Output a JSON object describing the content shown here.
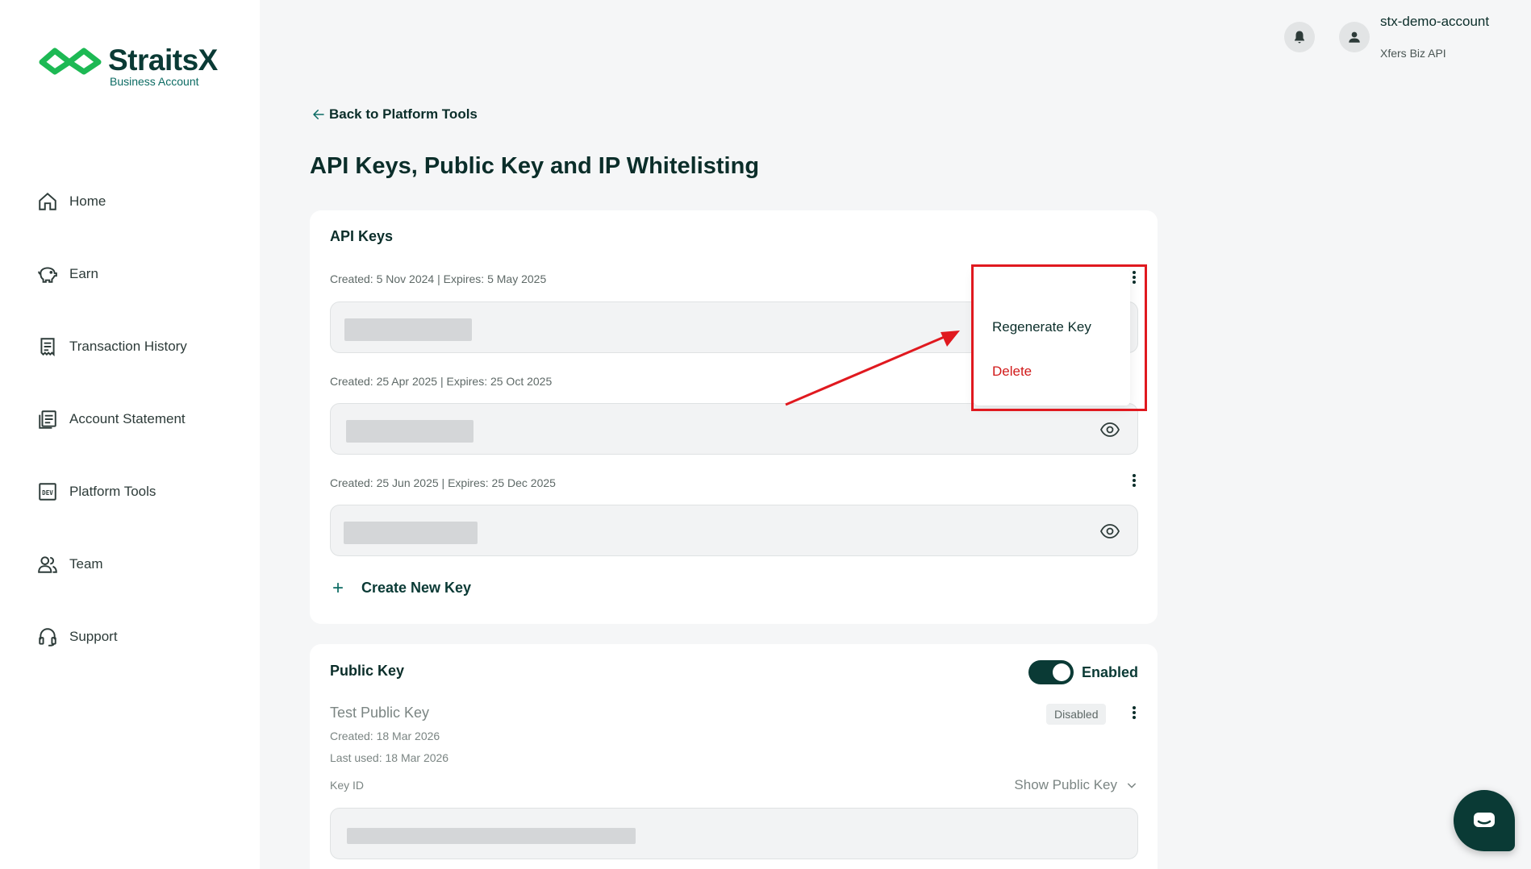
{
  "brand": {
    "name": "StraitsX",
    "subtitle": "Business Account",
    "accent": "#0a3a35",
    "logo_green": "#1db954"
  },
  "sidebar": {
    "items": [
      {
        "label": "Home",
        "icon": "home-icon"
      },
      {
        "label": "Earn",
        "icon": "piggy-bank-icon"
      },
      {
        "label": "Transaction History",
        "icon": "receipt-icon"
      },
      {
        "label": "Account Statement",
        "icon": "document-icon"
      },
      {
        "label": "Platform Tools",
        "icon": "dev-icon"
      },
      {
        "label": "Team",
        "icon": "team-icon"
      },
      {
        "label": "Support",
        "icon": "headset-icon"
      }
    ]
  },
  "header": {
    "account_name": "stx-demo-account",
    "account_sub": "Xfers Biz API"
  },
  "main": {
    "back_label": "Back to Platform Tools",
    "page_title": "API Keys, Public Key and IP Whitelisting"
  },
  "api_keys": {
    "title": "API Keys",
    "keys": [
      {
        "meta": "Created: 5 Nov 2024 | Expires: 5 May 2025"
      },
      {
        "meta": "Created: 25 Apr 2025 | Expires: 25 Oct 2025"
      },
      {
        "meta": "Created: 25 Jun 2025 | Expires: 25 Dec 2025"
      }
    ],
    "create_label": "Create New Key",
    "menu": {
      "regenerate": "Regenerate Key",
      "delete": "Delete"
    }
  },
  "public_key": {
    "title": "Public Key",
    "toggle_label": "Enabled",
    "toggle_on": true,
    "name": "Test Public Key",
    "created": "Created: 18 Mar 2026",
    "last_used": "Last used: 18 Mar 2026",
    "status_badge": "Disabled",
    "key_id_label": "Key ID",
    "show_label": "Show Public Key"
  }
}
